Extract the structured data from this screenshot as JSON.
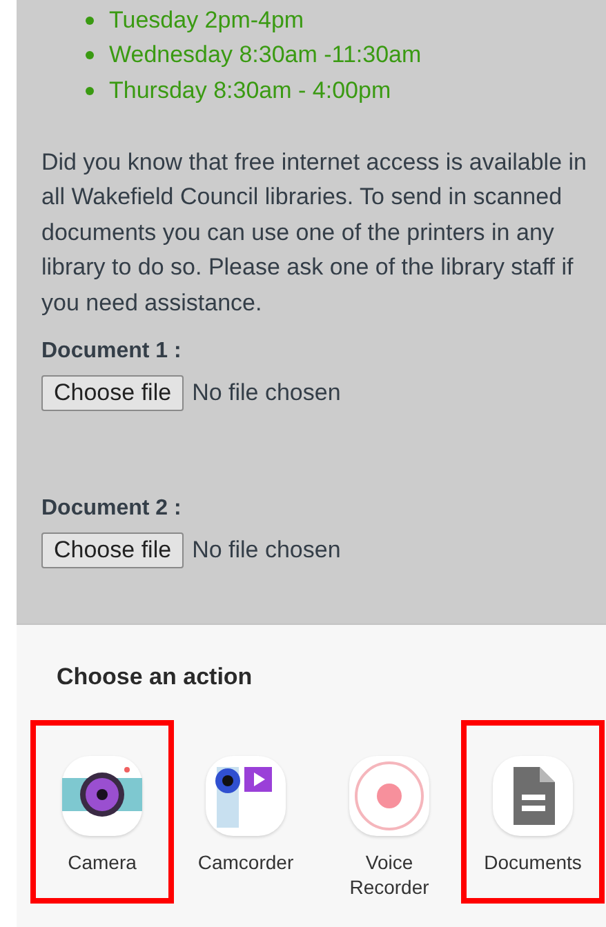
{
  "hours": [
    "Tuesday 2pm-4pm",
    "Wednesday 8:30am -11:30am",
    "Thursday 8:30am - 4:00pm"
  ],
  "info": "Did you know that free internet access is available in all Wakefield Council libraries. To send in scanned documents you can use one of the printers in any library to do so. Please ask one of the library staff if you need assistance.",
  "documents": [
    {
      "label": "Document 1 :",
      "button": "Choose file",
      "status": "No file chosen"
    },
    {
      "label": "Document 2 :",
      "button": "Choose file",
      "status": "No file chosen"
    }
  ],
  "sheet": {
    "title": "Choose an action",
    "actions": [
      {
        "kind": "camera",
        "label": "Camera",
        "highlighted": true
      },
      {
        "kind": "camcorder",
        "label": "Camcorder",
        "highlighted": false
      },
      {
        "kind": "recorder",
        "label": "Voice Recorder",
        "highlighted": false
      },
      {
        "kind": "documents",
        "label": "Documents",
        "highlighted": true
      }
    ]
  }
}
